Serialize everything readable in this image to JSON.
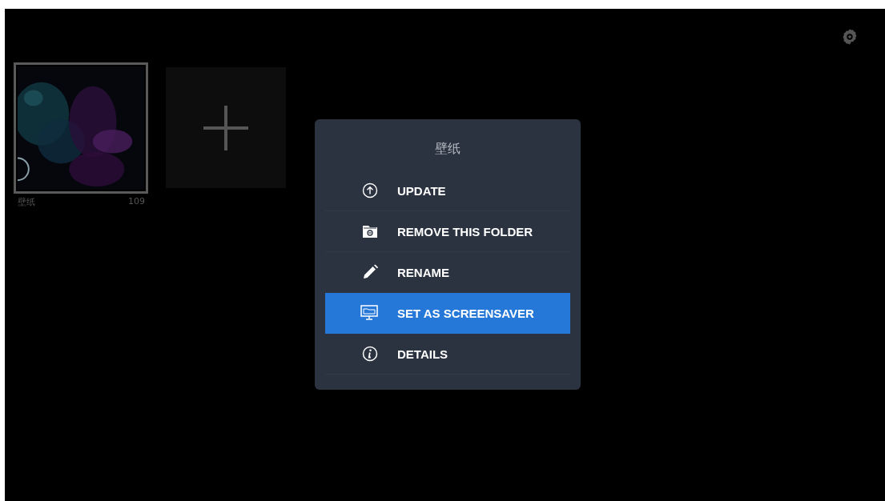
{
  "folders": [
    {
      "name": "壁纸",
      "count": "109",
      "selected": true,
      "kind": "picture"
    }
  ],
  "menu": {
    "title": "壁纸",
    "items": [
      {
        "label": "UPDATE",
        "kind": "update",
        "selected": false
      },
      {
        "label": "REMOVE THIS FOLDER",
        "kind": "remove",
        "selected": false
      },
      {
        "label": "RENAME",
        "kind": "rename",
        "selected": false
      },
      {
        "label": "SET AS SCREENSAVER",
        "kind": "screensaver",
        "selected": true
      },
      {
        "label": "DETAILS",
        "kind": "details",
        "selected": false
      }
    ]
  }
}
